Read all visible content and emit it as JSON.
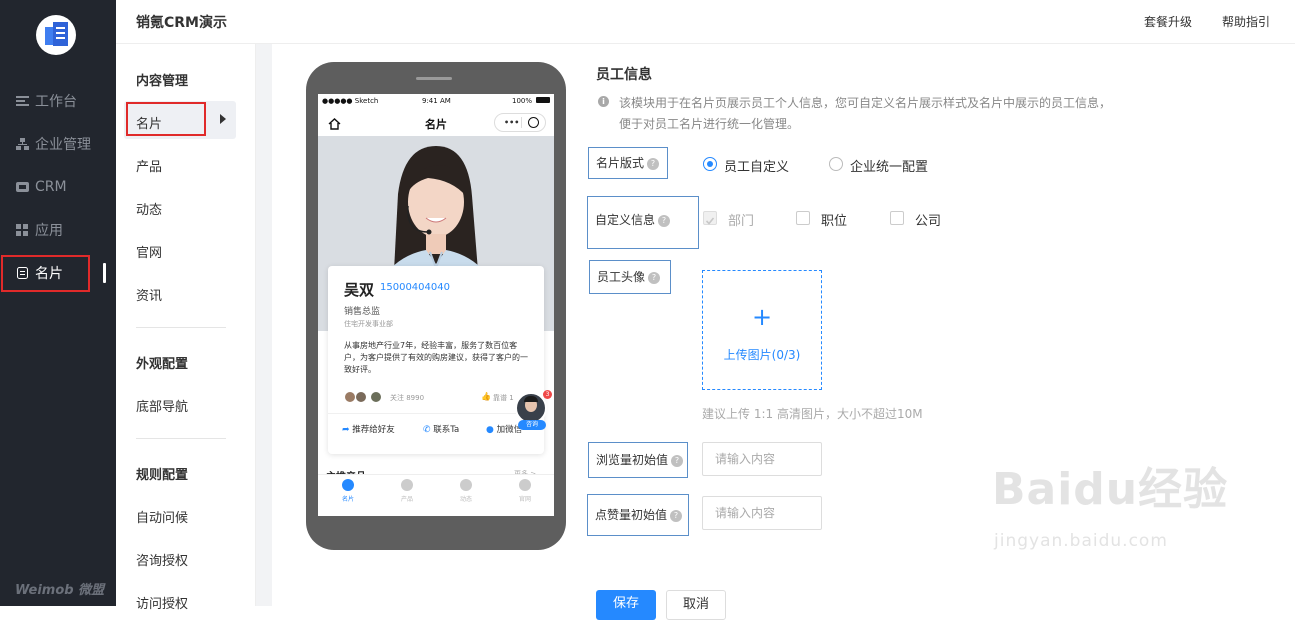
{
  "app": {
    "title": "销氪CRM演示",
    "brand": "Weimob 微盟"
  },
  "header": {
    "links": [
      "套餐升级",
      "帮助指引"
    ]
  },
  "sidebar": {
    "items": [
      {
        "label": "工作台",
        "icon": "workbench-icon"
      },
      {
        "label": "企业管理",
        "icon": "org-tree-icon"
      },
      {
        "label": "CRM",
        "icon": "crm-icon"
      },
      {
        "label": "应用",
        "icon": "apps-icon"
      },
      {
        "label": "名片",
        "icon": "card-icon",
        "active": true
      }
    ]
  },
  "subnav": {
    "groups": [
      {
        "title": "内容管理",
        "items": [
          "名片",
          "产品",
          "动态",
          "官网",
          "资讯"
        ]
      },
      {
        "title": "外观配置",
        "items": [
          "底部导航"
        ]
      },
      {
        "title": "规则配置",
        "items": [
          "自动问候",
          "咨询授权",
          "访问授权"
        ]
      }
    ],
    "selected": "名片"
  },
  "phone": {
    "status": {
      "carrier": "●●●●● Sketch",
      "time": "9:41 AM",
      "battery": "100%"
    },
    "page_title": "名片",
    "card": {
      "name": "吴双",
      "phone": "15000404040",
      "role": "销售总监",
      "dept": "住宅开发事业部",
      "bio": "从事房地产行业7年，经验丰富，服务了数百位客户，为客户提供了有效的购房建议，获得了客户的一致好评。",
      "followers": "关注 8990",
      "likes": "靠谱 1",
      "actions": [
        "推荐给好友",
        "联系Ta",
        "加微信"
      ],
      "consult": "咨询",
      "badge": "3"
    },
    "section": "主推产品",
    "section_more": "更多 >",
    "tabs": [
      "名片",
      "产品",
      "动态",
      "官网"
    ]
  },
  "form": {
    "title": "员工信息",
    "info": [
      "该模块用于在名片页展示员工个人信息，您可自定义名片展示样式及名片中展示的员工信息，",
      "便于对员工名片进行统一化管理。"
    ],
    "layout": {
      "label": "名片版式",
      "options": [
        "员工自定义",
        "企业统一配置"
      ],
      "selected": "员工自定义"
    },
    "custom": {
      "label": "自定义信息",
      "options": [
        "部门",
        "职位",
        "公司"
      ],
      "checked": [
        "部门"
      ],
      "disabled": [
        "部门"
      ]
    },
    "avatar": {
      "label": "员工头像",
      "upload": "上传图片(0/3)",
      "hint": "建议上传 1:1 高清图片，大小不超过10M"
    },
    "views": {
      "label": "浏览量初始值",
      "placeholder": "请输入内容"
    },
    "likes": {
      "label": "点赞量初始值",
      "placeholder": "请输入内容"
    },
    "save": "保存",
    "cancel": "取消"
  },
  "watermark": {
    "main": "Baidu经验",
    "sub": "jingyan.baidu.com"
  },
  "colors": {
    "accent": "#2589ff",
    "sidebar": "#22262e",
    "highlight": "#e02a2a"
  }
}
